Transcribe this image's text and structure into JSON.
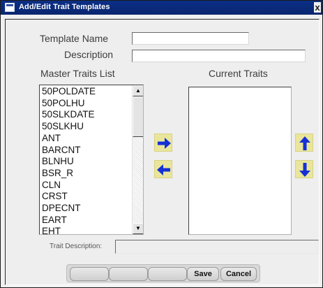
{
  "window": {
    "title": "Add/Edit Trait Templates",
    "close_glyph": "x"
  },
  "form": {
    "template_name_label": "Template Name",
    "template_name_value": "",
    "description_label": "Description",
    "description_value": ""
  },
  "master": {
    "heading": "Master Traits List",
    "items": [
      "50POLDATE",
      "50POLHU",
      "50SLKDATE",
      "50SLKHU",
      "ANT",
      "BARCNT",
      "BLNHU",
      "BSR_R",
      "CLN",
      "CRST",
      "DPECNT",
      "EART",
      "EHT"
    ],
    "scroll_up_icon": "triangle-up-icon",
    "scroll_down_icon": "triangle-down-icon"
  },
  "current": {
    "heading": "Current Traits",
    "items": []
  },
  "arrows": {
    "add_icon": "arrow-right-icon",
    "remove_icon": "arrow-left-icon",
    "move_up_icon": "arrow-up-icon",
    "move_down_icon": "arrow-down-icon",
    "arrow_color": "#1531d6",
    "button_color": "#e9e69c"
  },
  "trait_description": {
    "label": "Trait Description:",
    "value": ""
  },
  "buttons": {
    "blank_1": "",
    "blank_2": "",
    "blank_3": "",
    "save": "Save",
    "cancel": "Cancel"
  }
}
